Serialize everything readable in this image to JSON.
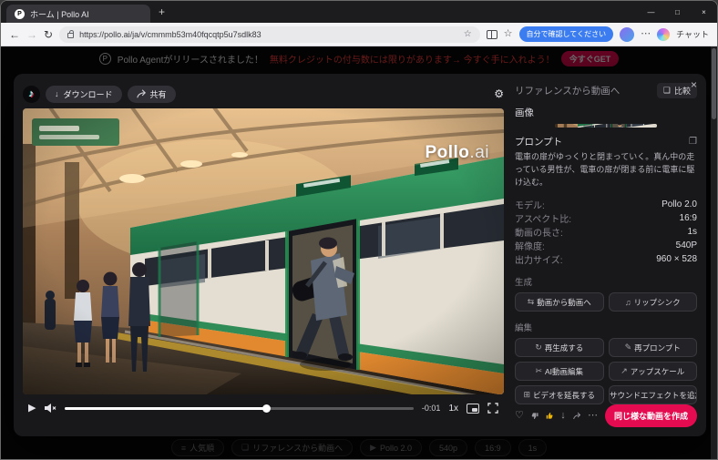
{
  "colors": {
    "accent_red": "#e50b51",
    "like_yellow": "#e8b40c",
    "verify_blue": "#3b7df0"
  },
  "browser": {
    "tab_title": "ホーム | Pollo AI",
    "url": "https://pollo.ai/ja/v/cmmmb53m40fqcqtp5u7sdlk83",
    "verify_button": "自分で確認してください",
    "chat_label": "チャット"
  },
  "banner": {
    "announcement": "Pollo Agentがリリースされました！",
    "offer": "無料クレジットの付与数には限りがあります→ 今すぐ手に入れよう！",
    "cta": "今すぐGET"
  },
  "player": {
    "download": "ダウンロード",
    "share": "共有",
    "watermark_bold": "Pollo",
    "watermark_light": ".ai",
    "time_remaining": "-0:01",
    "speed": "1x",
    "progress_pct": 58
  },
  "panel": {
    "title": "リファレンスから動画へ",
    "compare": "比較",
    "image_label": "画像",
    "prompt_label": "プロンプト",
    "prompt": "電車の扉がゆっくりと閉まっていく。真ん中の走っている男性が、電車の扉が閉まる前に電車に駆け込む。",
    "details": [
      {
        "label": "モデル:",
        "value": "Pollo 2.0"
      },
      {
        "label": "アスペクト比:",
        "value": "16:9"
      },
      {
        "label": "動画の長さ:",
        "value": "1s"
      },
      {
        "label": "解像度:",
        "value": "540P"
      },
      {
        "label": "出力サイズ:",
        "value": "960 × 528"
      }
    ],
    "generate_title": "生成",
    "generate": [
      {
        "label": "動画から動画へ",
        "icon": "⇆"
      },
      {
        "label": "リップシンク",
        "icon": "♫"
      }
    ],
    "edit_title": "編集",
    "edit": [
      {
        "label": "再生成する",
        "icon": "↻"
      },
      {
        "label": "再プロンプト",
        "icon": "✎"
      },
      {
        "label": "AI動画編集",
        "icon": "✂"
      },
      {
        "label": "アップスケール",
        "icon": "↗"
      },
      {
        "label": "ビデオを延長する",
        "icon": "⊞"
      },
      {
        "label": "サウンドエフェクトを追加",
        "icon": "♪"
      }
    ],
    "create_similar": "同じ様な動画を作成"
  },
  "footer_chips": [
    {
      "icon": "≡",
      "label": "人気順"
    },
    {
      "icon": "❏",
      "label": "リファレンスから動画へ"
    },
    {
      "icon": "▶",
      "label": "Pollo 2.0"
    },
    {
      "icon": "",
      "label": "540p"
    },
    {
      "icon": "",
      "label": "16:9"
    },
    {
      "icon": "",
      "label": "1s"
    }
  ],
  "icons": {
    "favicon": "P",
    "banner_logo": "P",
    "back": "←",
    "forward": "→",
    "refresh": "↻",
    "star": "☆",
    "new_tab": "+",
    "minimize": "—",
    "maximize": "□",
    "close": "×",
    "more": "⋯",
    "music_note": "♪",
    "download": "↓",
    "gear": "⚙",
    "play": "▶",
    "compare": "❏",
    "copy": "❐",
    "heart": "♡"
  }
}
